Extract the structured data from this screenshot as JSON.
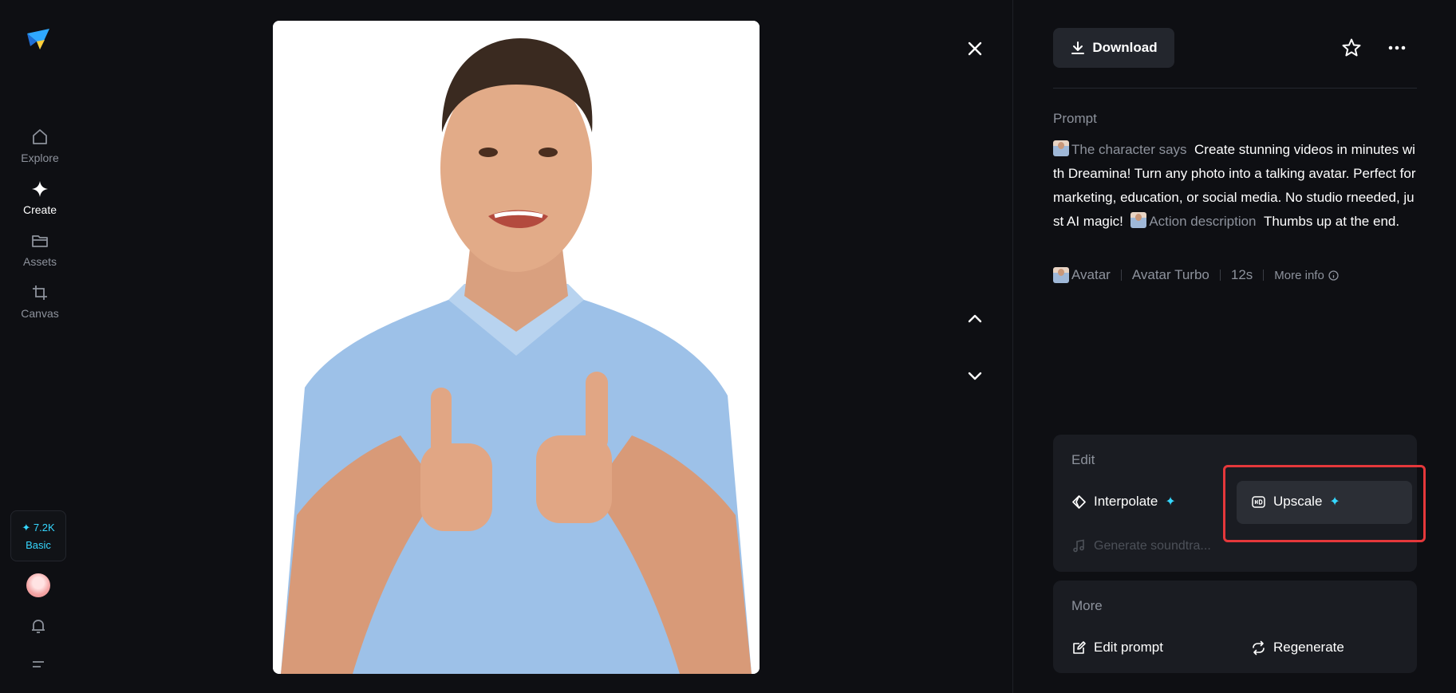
{
  "nav": {
    "items": [
      {
        "label": "Explore",
        "icon": "home-icon"
      },
      {
        "label": "Create",
        "icon": "sparkle-icon"
      },
      {
        "label": "Assets",
        "icon": "folder-icon"
      },
      {
        "label": "Canvas",
        "icon": "crop-icon"
      }
    ],
    "credits": {
      "amount": "✦ 7.2K",
      "plan": "Basic"
    }
  },
  "panel": {
    "download_label": "Download",
    "prompt_label": "Prompt",
    "prompt": {
      "says_label": "The character says",
      "says_text": "Create stunning videos in minutes with Dreamina! Turn any photo into a talking avatar. Perfect for marketing, education, or social media. No studio rneeded, just AI magic!",
      "action_label": "Action description",
      "action_text": "Thumbs up at the end."
    },
    "meta": {
      "model_type": "Avatar",
      "model_name": "Avatar Turbo",
      "duration": "12s",
      "more_info": "More info"
    },
    "edit": {
      "title": "Edit",
      "interpolate": "Interpolate",
      "upscale": "Upscale",
      "soundtrack": "Generate soundtra..."
    },
    "more": {
      "title": "More",
      "edit_prompt": "Edit prompt",
      "regenerate": "Regenerate"
    }
  },
  "colors": {
    "accent": "#35d7ff",
    "highlight": "#e5383b",
    "background": "#0e0f13"
  }
}
